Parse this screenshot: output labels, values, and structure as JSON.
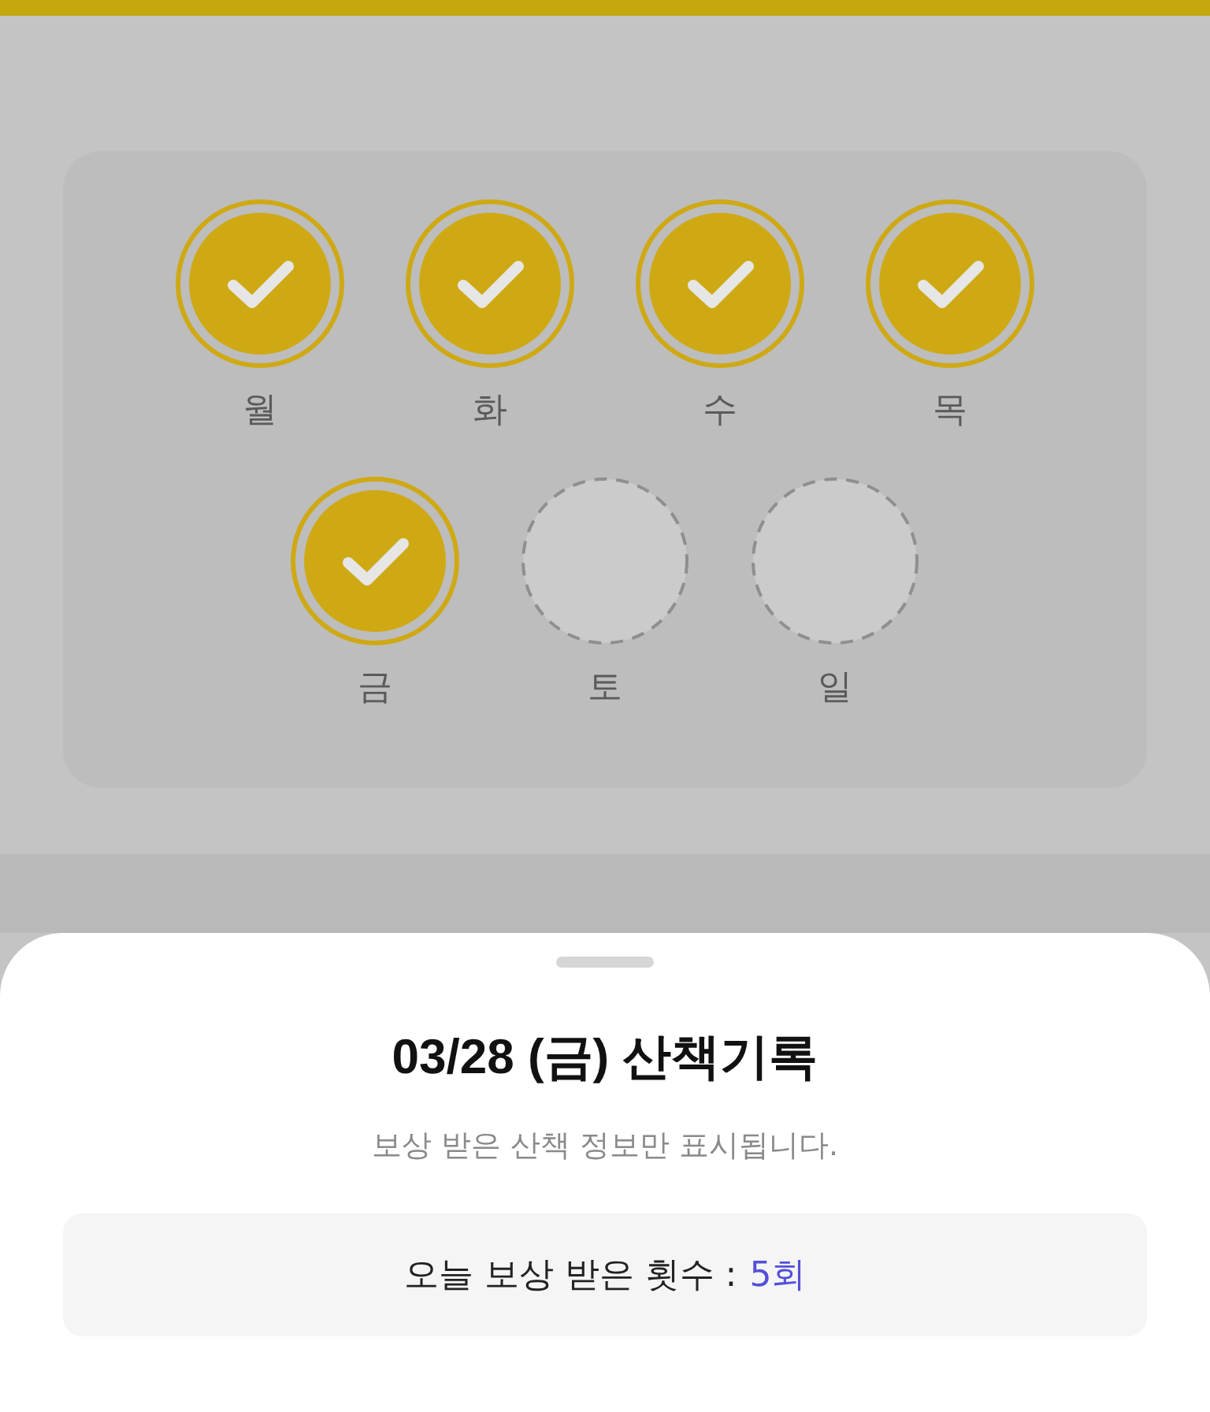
{
  "days": [
    {
      "label": "월",
      "checked": true
    },
    {
      "label": "화",
      "checked": true
    },
    {
      "label": "수",
      "checked": true
    },
    {
      "label": "목",
      "checked": true
    },
    {
      "label": "금",
      "checked": true
    },
    {
      "label": "토",
      "checked": false
    },
    {
      "label": "일",
      "checked": false
    }
  ],
  "sheet": {
    "title": "03/28 (금) 산책기록",
    "subtitle": "보상 받은 산책 정보만 표시됩니다.",
    "count_label": "오늘 보상 받은 횟수 :",
    "count_value": "5회"
  }
}
